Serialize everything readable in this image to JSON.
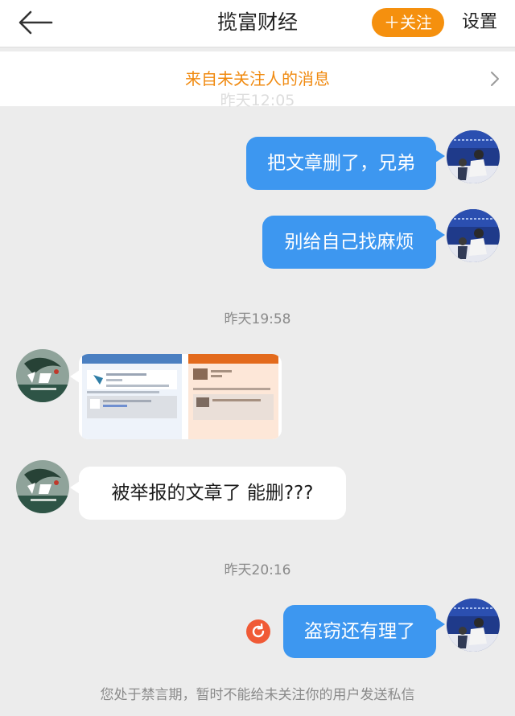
{
  "header": {
    "title": "揽富财经",
    "follow_label": "＋关注",
    "settings_label": "设置"
  },
  "notice": {
    "text": "来自未关注人的消息"
  },
  "messages": {
    "time_faded": "昨天12:05",
    "sent_1": "把文章删了，兄弟",
    "sent_2": "别给自己找麻烦",
    "time_2": "昨天19:58",
    "received_text": "被举报的文章了  能删???",
    "time_3": "昨天20:16",
    "sent_3": "盗窃还有理了"
  },
  "footer": {
    "text": "您处于禁言期，暂时不能给未关注你的用户发送私信"
  },
  "colors": {
    "accent_orange": "#f5900e",
    "notice_orange": "#f08a10",
    "bubble_blue": "#3d97f0",
    "retry_red": "#f05a36",
    "background": "#ececec"
  },
  "icons": {
    "back": "back-arrow-icon",
    "chevron": "chevron-right-icon",
    "retry": "resend-icon"
  }
}
